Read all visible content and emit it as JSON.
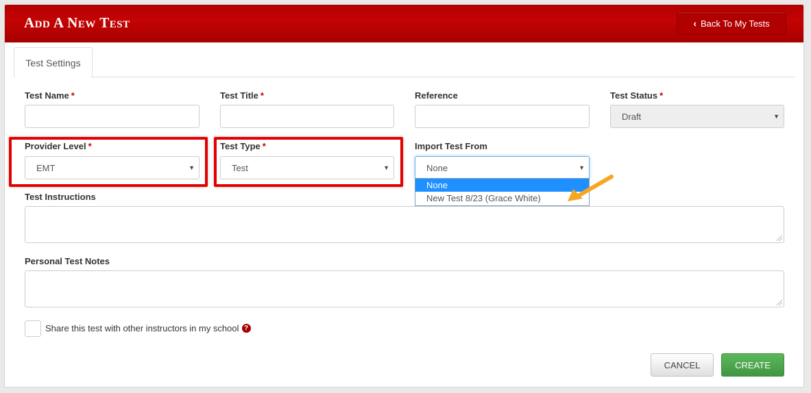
{
  "header": {
    "title": "Add A New Test",
    "back_label": "Back To My Tests"
  },
  "tabs": [
    {
      "label": "Test Settings",
      "active": true
    }
  ],
  "form": {
    "required_mark": "*",
    "test_name": {
      "label": "Test Name",
      "value": ""
    },
    "test_title": {
      "label": "Test Title",
      "value": ""
    },
    "reference": {
      "label": "Reference",
      "value": ""
    },
    "test_status": {
      "label": "Test Status",
      "value": "Draft"
    },
    "provider_level": {
      "label": "Provider Level",
      "value": "EMT"
    },
    "test_type": {
      "label": "Test Type",
      "value": "Test"
    },
    "import_from": {
      "label": "Import Test From",
      "value": "None",
      "options": [
        "None",
        "New Test 8/23 (Grace White)"
      ]
    },
    "instructions": {
      "label": "Test Instructions"
    },
    "notes": {
      "label": "Personal Test Notes"
    },
    "share": {
      "label": "Share this test with other instructors in my school",
      "checked": false
    }
  },
  "buttons": {
    "cancel": "Cancel",
    "create": "Create"
  },
  "colors": {
    "header": "#c40303",
    "highlight": "#e50000",
    "arrow": "#f5a623",
    "create": "#4cae4c",
    "selected_option": "#1e90ff"
  }
}
